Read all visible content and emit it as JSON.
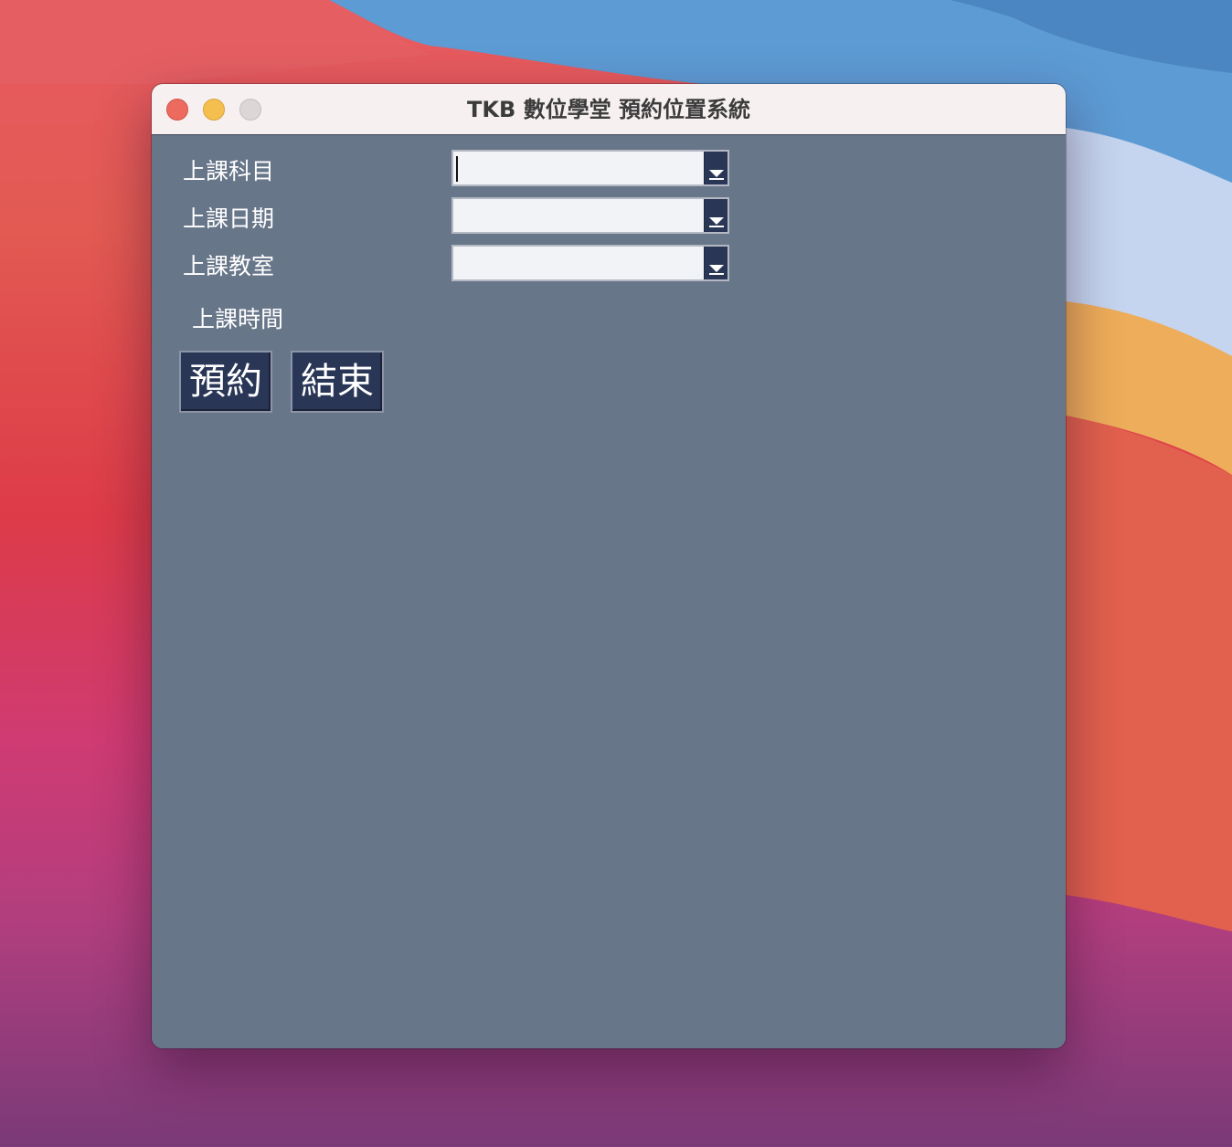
{
  "window": {
    "title": "TKB 數位學堂 預約位置系統"
  },
  "form": {
    "subject_label": "上課科目",
    "subject_value": "",
    "date_label": "上課日期",
    "date_value": "",
    "classroom_label": "上課教室",
    "classroom_value": "",
    "time_label": "上課時間"
  },
  "buttons": {
    "reserve_label": "預約",
    "exit_label": "結束"
  },
  "colors": {
    "window_background": "#68768a",
    "button_background": "#2a3656",
    "titlebar_background": "#f6f0f0"
  },
  "icons": {
    "dropdown": "chevron-down-icon",
    "close": "close-icon",
    "minimize": "minimize-icon",
    "zoom": "zoom-icon"
  }
}
